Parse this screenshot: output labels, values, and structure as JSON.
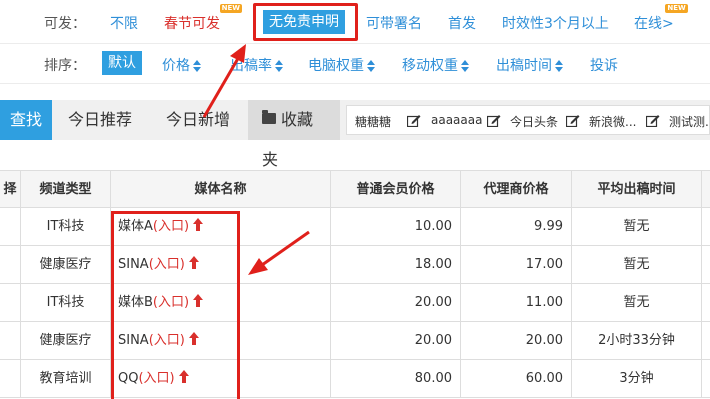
{
  "filter": {
    "label": "可发：",
    "options": [
      {
        "label": "不限",
        "red": false,
        "badge": ""
      },
      {
        "label": "春节可发",
        "red": true,
        "badge": "NEW"
      },
      {
        "label": "无免责申明",
        "red": false,
        "badge": "",
        "active": true
      },
      {
        "label": "可带署名",
        "red": false,
        "badge": ""
      },
      {
        "label": "首发",
        "red": false,
        "badge": ""
      },
      {
        "label": "时效性3个月以上",
        "red": false,
        "badge": ""
      },
      {
        "label": "在线",
        "red": false,
        "badge": "NEW"
      }
    ]
  },
  "sort": {
    "label": "排序：",
    "options": [
      "默认",
      "价格",
      "出稿率",
      "电脑权重",
      "移动权重",
      "出稿时间",
      "投诉"
    ]
  },
  "toolbar": {
    "search_label": "查找",
    "tabs": [
      "今日推荐",
      "今日新增",
      "收藏夹"
    ],
    "shortcuts": [
      "糖糖糖",
      "aaaaaaa",
      "今日头条",
      "新浪微...",
      "测试测..."
    ]
  },
  "table": {
    "headers": [
      "择",
      "频道类型",
      "媒体名称",
      "普通会员价格",
      "代理商价格",
      "平均出稿时间"
    ],
    "entry_label": "(入口)",
    "rows": [
      {
        "channel": "IT科技",
        "media": "媒体A",
        "member_price": "10.00",
        "agent_price": "9.99",
        "avg_time": "暂无"
      },
      {
        "channel": "健康医疗",
        "media": "SINA",
        "member_price": "18.00",
        "agent_price": "17.00",
        "avg_time": "暂无"
      },
      {
        "channel": "IT科技",
        "media": "媒体B",
        "member_price": "20.00",
        "agent_price": "11.00",
        "avg_time": "暂无"
      },
      {
        "channel": "健康医疗",
        "media": "SINA",
        "member_price": "20.00",
        "agent_price": "20.00",
        "avg_time": "2小时33分钟"
      },
      {
        "channel": "教育培训",
        "media": "QQ",
        "member_price": "80.00",
        "agent_price": "60.00",
        "avg_time": "3分钟"
      }
    ]
  },
  "colors": {
    "accent": "#2f9fe0",
    "link": "#2f8fd8",
    "highlight": "#e0201b"
  }
}
